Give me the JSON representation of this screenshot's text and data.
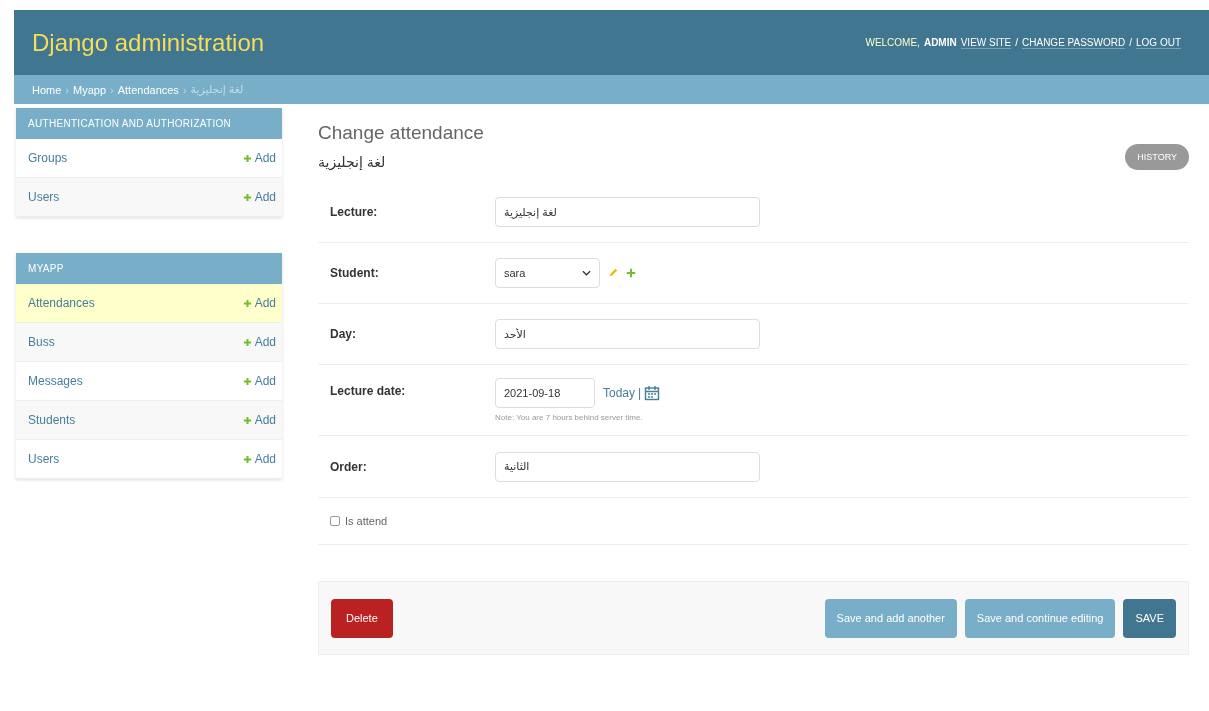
{
  "header": {
    "title": "Django administration",
    "welcome": "WELCOME,",
    "user": "ADMIN",
    "separator": "/",
    "links": [
      {
        "label": "VIEW SITE"
      },
      {
        "label": "CHANGE PASSWORD"
      },
      {
        "label": "LOG OUT"
      }
    ]
  },
  "breadcrumbs": {
    "separator": "›",
    "items": [
      {
        "label": "Home",
        "link": true
      },
      {
        "label": "Myapp",
        "link": true
      },
      {
        "label": "Attendances",
        "link": true
      },
      {
        "label": "لغة إنجليزية",
        "link": false
      }
    ]
  },
  "sidebar": {
    "modules": [
      {
        "caption": "AUTHENTICATION AND AUTHORIZATION",
        "rows": [
          {
            "name": "Groups",
            "add": "Add",
            "selected": false
          },
          {
            "name": "Users",
            "add": "Add",
            "selected": false
          }
        ]
      },
      {
        "caption": "MYAPP",
        "rows": [
          {
            "name": "Attendances",
            "add": "Add",
            "selected": true
          },
          {
            "name": "Buss",
            "add": "Add",
            "selected": false
          },
          {
            "name": "Messages",
            "add": "Add",
            "selected": false
          },
          {
            "name": "Students",
            "add": "Add",
            "selected": false
          },
          {
            "name": "Users",
            "add": "Add",
            "selected": false
          }
        ]
      }
    ]
  },
  "content": {
    "title": "Change attendance",
    "history": "HISTORY",
    "object_title": "لغة إنجليزية",
    "fields": [
      {
        "kind": "text",
        "label": "Lecture:",
        "value": "لغة إنجليزية"
      },
      {
        "kind": "select",
        "label": "Student:",
        "value": "sara"
      },
      {
        "kind": "text",
        "label": "Day:",
        "value": "الأحد"
      },
      {
        "kind": "date",
        "label": "Lecture date:",
        "value": "2021-09-18",
        "today": "Today",
        "separator": "|",
        "help": "Note: You are 7 hours behind server time."
      },
      {
        "kind": "text",
        "label": "Order:",
        "value": "الثانية"
      }
    ],
    "checkbox": {
      "label": "Is attend",
      "checked": false
    },
    "delete": "Delete",
    "buttons": [
      {
        "label": "Save and add another",
        "kind": "secondary"
      },
      {
        "label": "Save and continue editing",
        "kind": "secondary"
      },
      {
        "label": "SAVE",
        "kind": "primary"
      }
    ]
  }
}
